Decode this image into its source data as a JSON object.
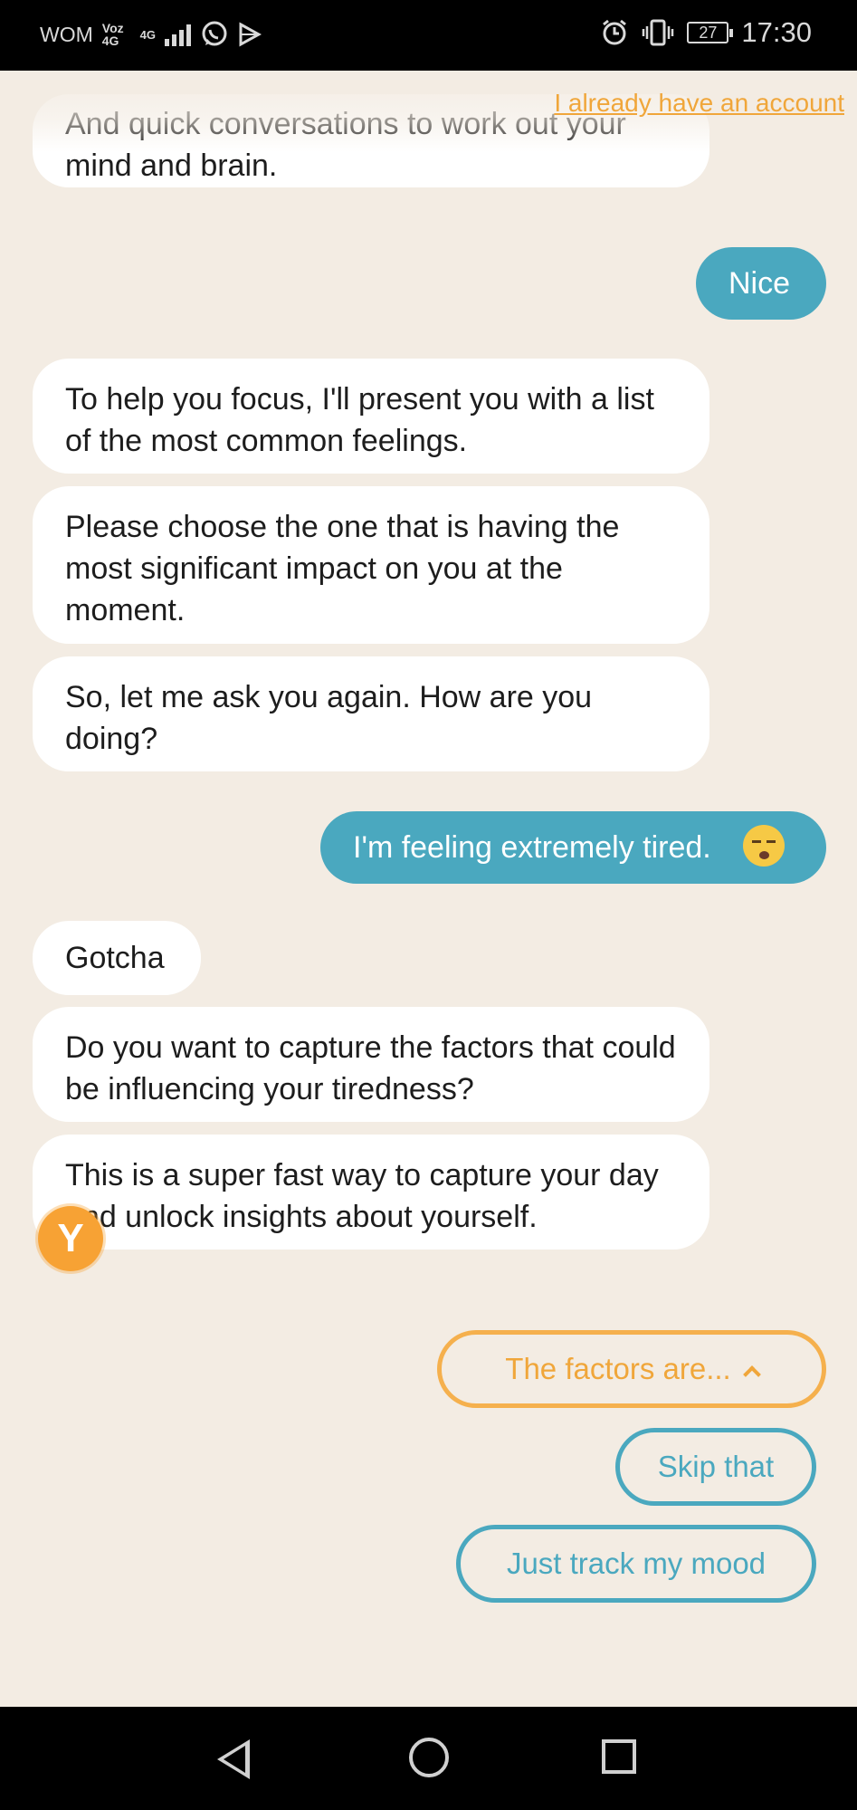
{
  "status_bar": {
    "carrier": "WOM",
    "network_top": "Voz",
    "network_bottom": "4G",
    "signal_label": "4G",
    "battery": "27",
    "time": "17:30"
  },
  "header": {
    "login_link": "I already have an account"
  },
  "messages": [
    {
      "from": "bot",
      "text": "And quick conversations to work out your mind and brain."
    },
    {
      "from": "user",
      "text": "Nice"
    },
    {
      "from": "bot",
      "text": "To help you focus, I'll present you with a list of the most common feelings."
    },
    {
      "from": "bot",
      "text": "Please choose the one that is having the most significant impact on you at the moment."
    },
    {
      "from": "bot",
      "text": "So, let me ask you again. How are you doing?"
    },
    {
      "from": "user",
      "text": "I'm feeling extremely tired."
    },
    {
      "from": "bot",
      "text": "Gotcha"
    },
    {
      "from": "bot",
      "text": "Do you want to capture the factors that could be influencing your tiredness?"
    },
    {
      "from": "bot",
      "text": "This is a super fast way to capture your day and unlock insights about yourself."
    }
  ],
  "avatar_letter": "Y",
  "options": {
    "factors": "The factors are...",
    "skip": "Skip that",
    "track": "Just track my mood"
  },
  "colors": {
    "background": "#f3ece3",
    "user_bubble": "#4aa8bf",
    "accent_orange": "#f0a63a"
  }
}
